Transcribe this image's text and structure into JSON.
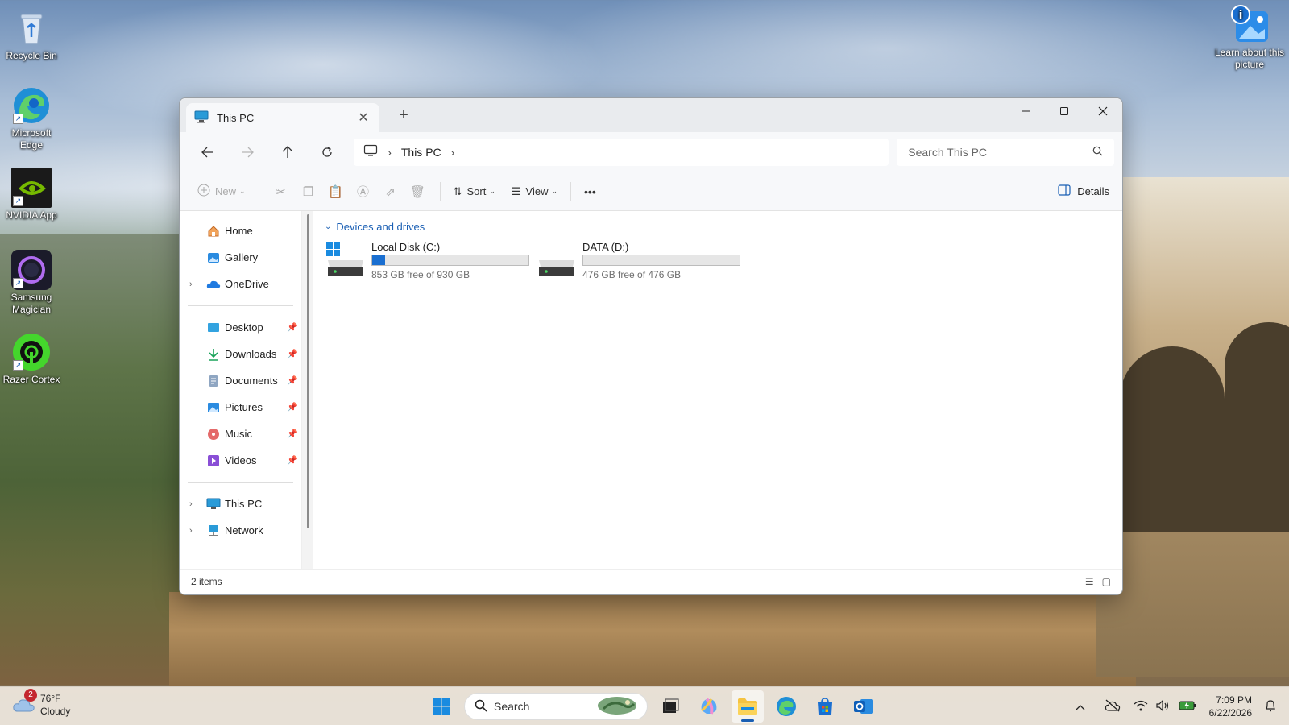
{
  "desktop": {
    "icons": [
      {
        "label": "Recycle Bin"
      },
      {
        "label": "Microsoft Edge"
      },
      {
        "label": "NVIDIA App"
      },
      {
        "label": "Samsung Magician"
      },
      {
        "label": "Razer Cortex"
      }
    ],
    "learn_about": "Learn about this picture"
  },
  "window": {
    "tab_title": "This PC",
    "new_tab": "+",
    "address": {
      "crumb": "This PC"
    },
    "search_placeholder": "Search This PC",
    "commands": {
      "new": "New",
      "sort": "Sort",
      "view": "View",
      "more": "•••",
      "details": "Details"
    },
    "sidebar": {
      "top": [
        {
          "label": "Home"
        },
        {
          "label": "Gallery"
        },
        {
          "label": "OneDrive"
        }
      ],
      "pinned": [
        {
          "label": "Desktop"
        },
        {
          "label": "Downloads"
        },
        {
          "label": "Documents"
        },
        {
          "label": "Pictures"
        },
        {
          "label": "Music"
        },
        {
          "label": "Videos"
        }
      ],
      "bottom": [
        {
          "label": "This PC"
        },
        {
          "label": "Network"
        }
      ]
    },
    "content": {
      "group_title": "Devices and drives",
      "drives": [
        {
          "name": "Local Disk (C:)",
          "free_text": "853 GB free of 930 GB",
          "used_fraction": 0.083
        },
        {
          "name": "DATA (D:)",
          "free_text": "476 GB free of 476 GB",
          "used_fraction": 0.0
        }
      ]
    },
    "status": "2 items"
  },
  "taskbar": {
    "weather": {
      "temp": "76°F",
      "condition": "Cloudy",
      "badge": "2"
    },
    "search_placeholder": "Search",
    "time": "7:09 PM",
    "date": "6/22/2026"
  },
  "colors": {
    "accent": "#1a6fd1",
    "window_bg": "#ffffff",
    "titlebar_bg": "#e9ebee"
  }
}
